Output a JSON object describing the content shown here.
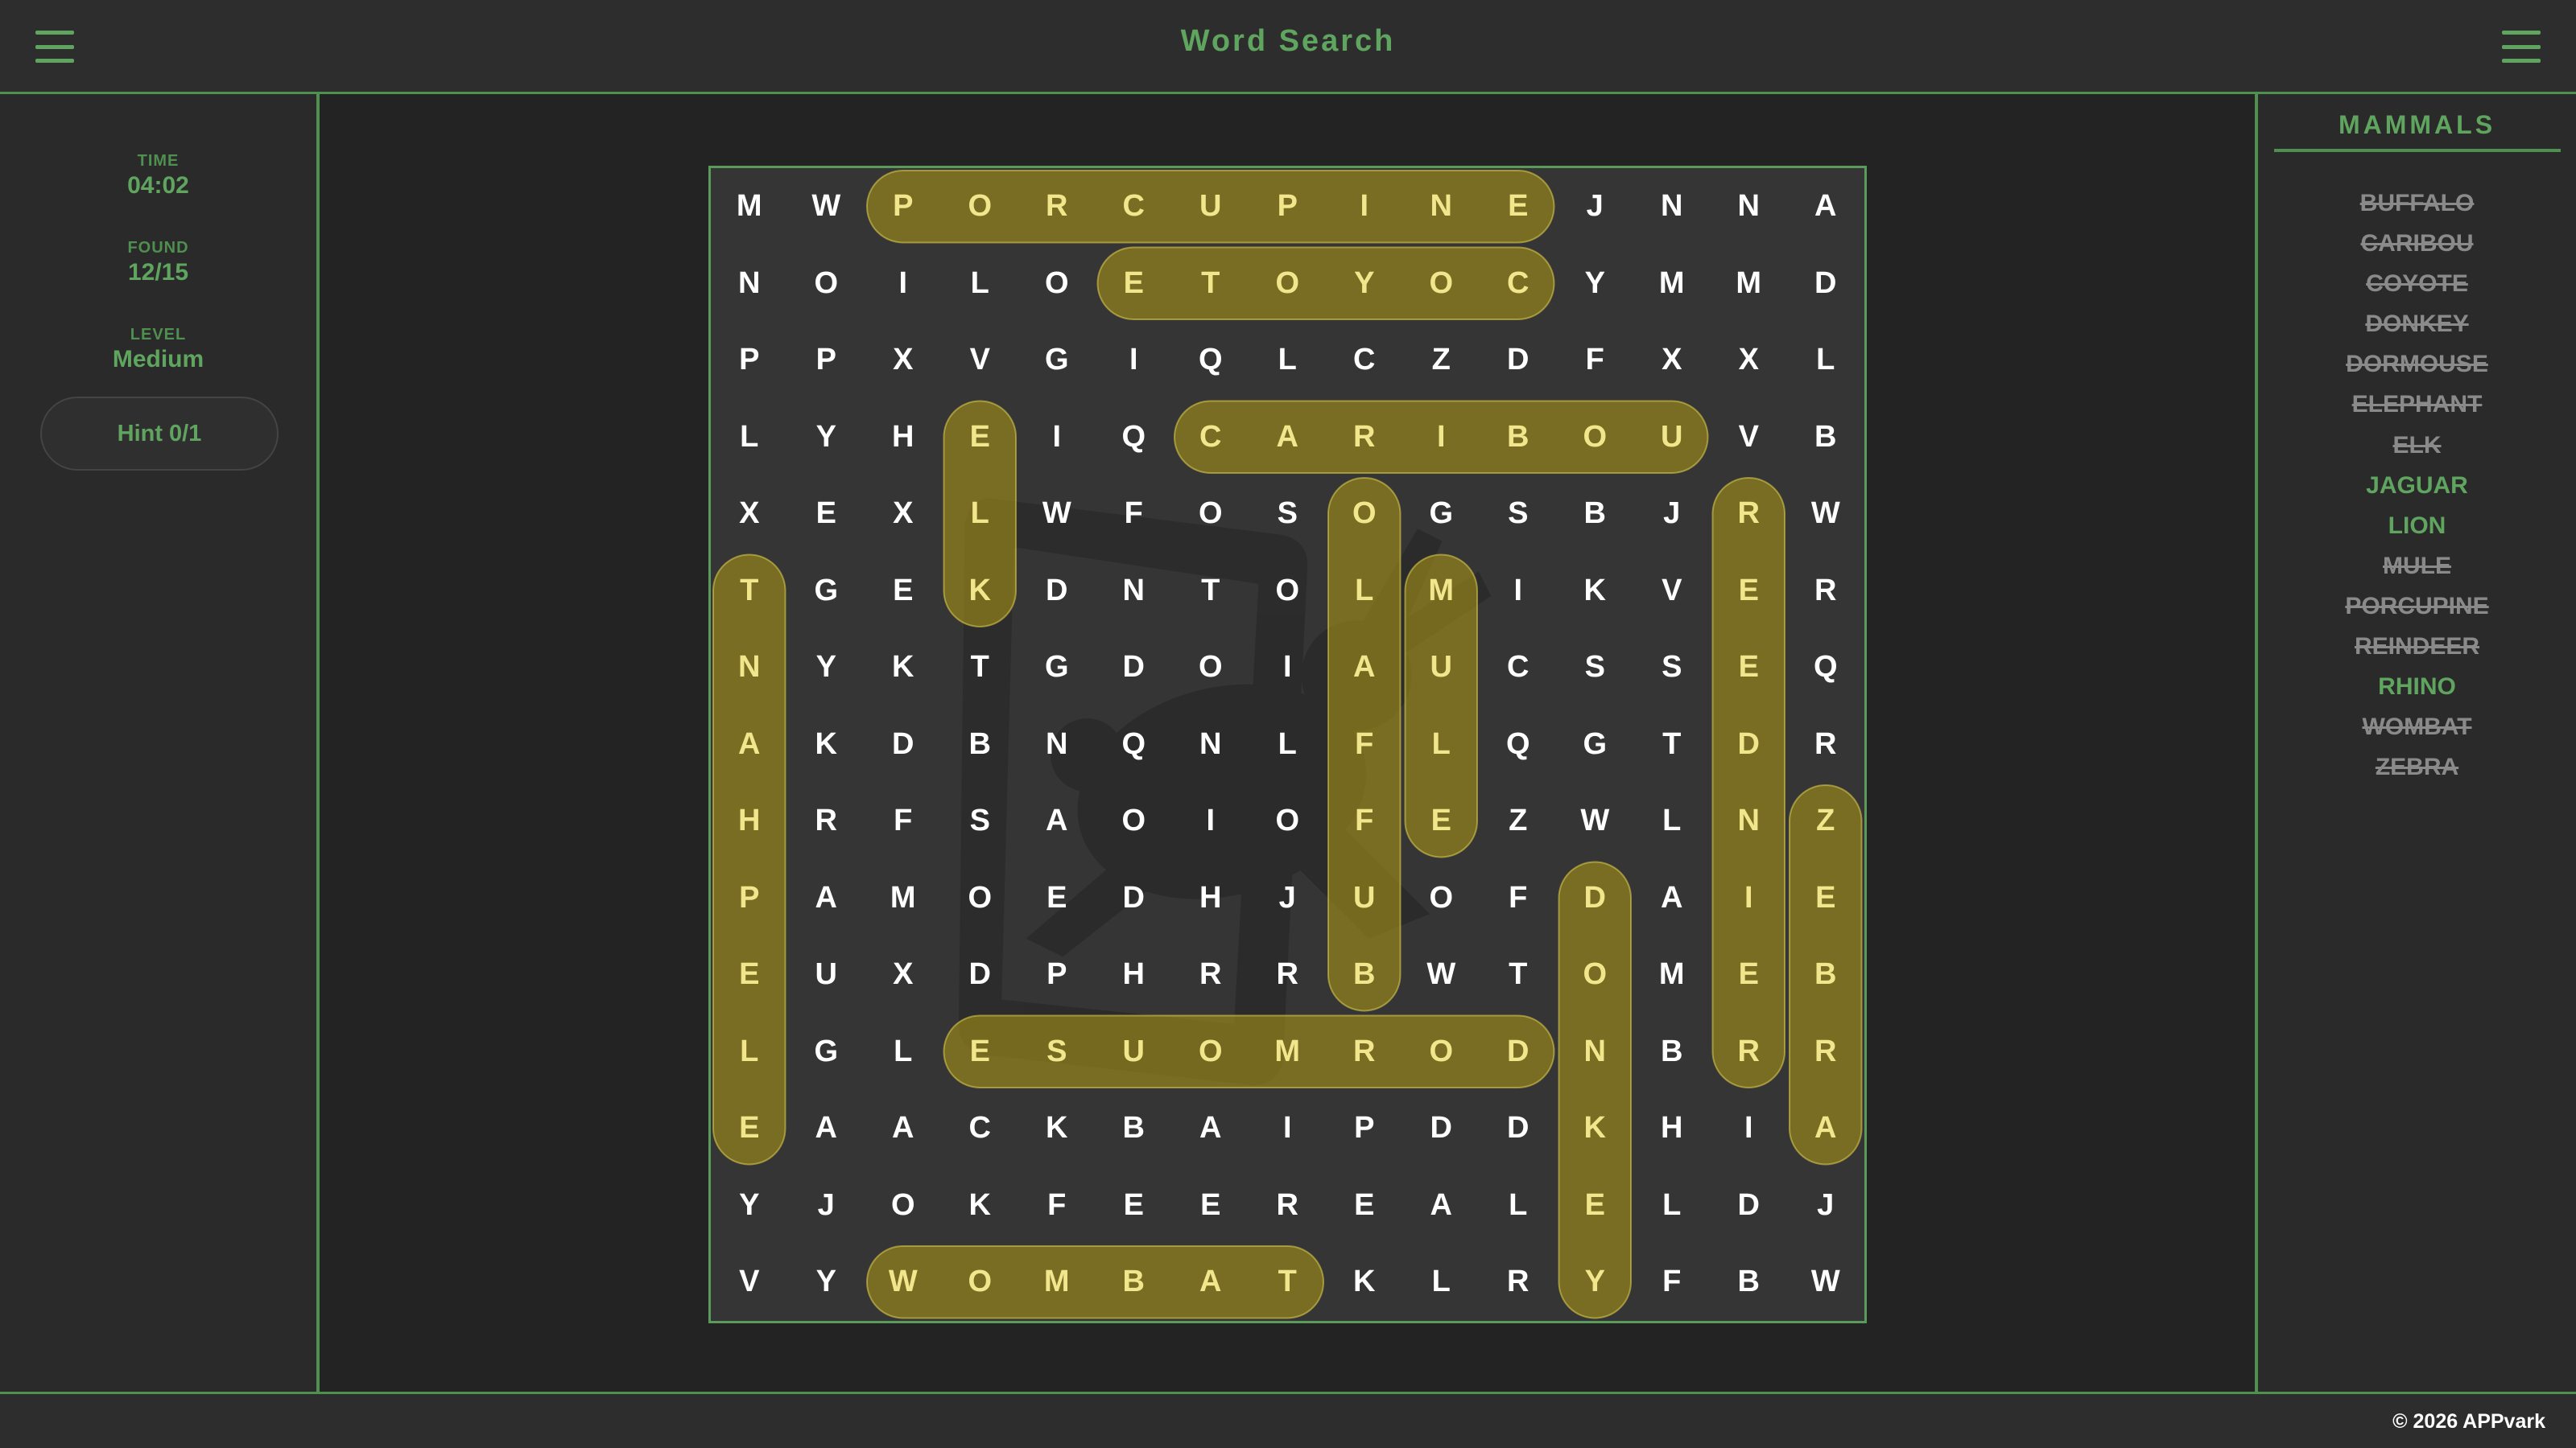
{
  "app": {
    "title": "Word Search"
  },
  "stats": {
    "time_label": "TIME",
    "time_value": "04:02",
    "found_label": "FOUND",
    "found_value": "12/15",
    "level_label": "LEVEL",
    "level_value": "Medium"
  },
  "hint": {
    "label": "Hint  0/1"
  },
  "icons": {
    "menu_left": "hamburger-menu-icon",
    "menu_right": "hamburger-menu-icon",
    "watermark": "rabbit-watermark-icon"
  },
  "colors": {
    "accent": "#5fa55f",
    "highlight": "#a89614",
    "found_letter": "#f2e68c"
  },
  "grid": [
    "MWPORCUPINEJNNA",
    "NOILOETOYOCYMMD",
    "PPXVGIQLCZDFXXL",
    "LYHEIQCARIBOUVB",
    "XEXLWFOSOGSBJRW",
    "TGEKDNTOLMIKVER",
    "NYKTGDOIAUCSSEQ",
    "AKDBNQNLFLQGTDR",
    "HRFSAOIOFEZWLNZ",
    "PAMOEDHJUOFDAIE",
    "EUXDPHRRBWTOMEB",
    "LGLESUOMRODNBRR",
    "EAACKBAIPDDKHIA",
    "YJOKFEEREALELDJ",
    "VYWOMBATKLRYFBW"
  ],
  "found_words": [
    {
      "word": "PORCUPINE",
      "start": [
        0,
        2
      ],
      "end": [
        0,
        10
      ]
    },
    {
      "word": "COYOTE",
      "start": [
        1,
        10
      ],
      "end": [
        1,
        5
      ]
    },
    {
      "word": "CARIBOU",
      "start": [
        3,
        6
      ],
      "end": [
        3,
        12
      ]
    },
    {
      "word": "ELK",
      "start": [
        3,
        3
      ],
      "end": [
        5,
        3
      ]
    },
    {
      "word": "BUFFALO",
      "start": [
        10,
        8
      ],
      "end": [
        4,
        8
      ]
    },
    {
      "word": "MULE",
      "start": [
        5,
        9
      ],
      "end": [
        8,
        9
      ]
    },
    {
      "word": "REINDEER",
      "start": [
        11,
        13
      ],
      "end": [
        4,
        13
      ]
    },
    {
      "word": "ELEPHANT",
      "start": [
        12,
        0
      ],
      "end": [
        5,
        0
      ]
    },
    {
      "word": "ZEBRA",
      "start": [
        8,
        14
      ],
      "end": [
        12,
        14
      ]
    },
    {
      "word": "DONKEY",
      "start": [
        9,
        11
      ],
      "end": [
        14,
        11
      ]
    },
    {
      "word": "DORMOUSE",
      "start": [
        11,
        10
      ],
      "end": [
        11,
        3
      ]
    },
    {
      "word": "WOMBAT",
      "start": [
        14,
        2
      ],
      "end": [
        14,
        7
      ]
    }
  ],
  "category": {
    "title": "MAMMALS"
  },
  "words": [
    {
      "text": "BUFFALO",
      "found": true
    },
    {
      "text": "CARIBOU",
      "found": true
    },
    {
      "text": "COYOTE",
      "found": true
    },
    {
      "text": "DONKEY",
      "found": true
    },
    {
      "text": "DORMOUSE",
      "found": true
    },
    {
      "text": "ELEPHANT",
      "found": true
    },
    {
      "text": "ELK",
      "found": true
    },
    {
      "text": "JAGUAR",
      "found": false
    },
    {
      "text": "LION",
      "found": false
    },
    {
      "text": "MULE",
      "found": true
    },
    {
      "text": "PORCUPINE",
      "found": true
    },
    {
      "text": "REINDEER",
      "found": true
    },
    {
      "text": "RHINO",
      "found": false
    },
    {
      "text": "WOMBAT",
      "found": true
    },
    {
      "text": "ZEBRA",
      "found": true
    }
  ],
  "footer": {
    "copyright": "© 2026 APPvark"
  }
}
